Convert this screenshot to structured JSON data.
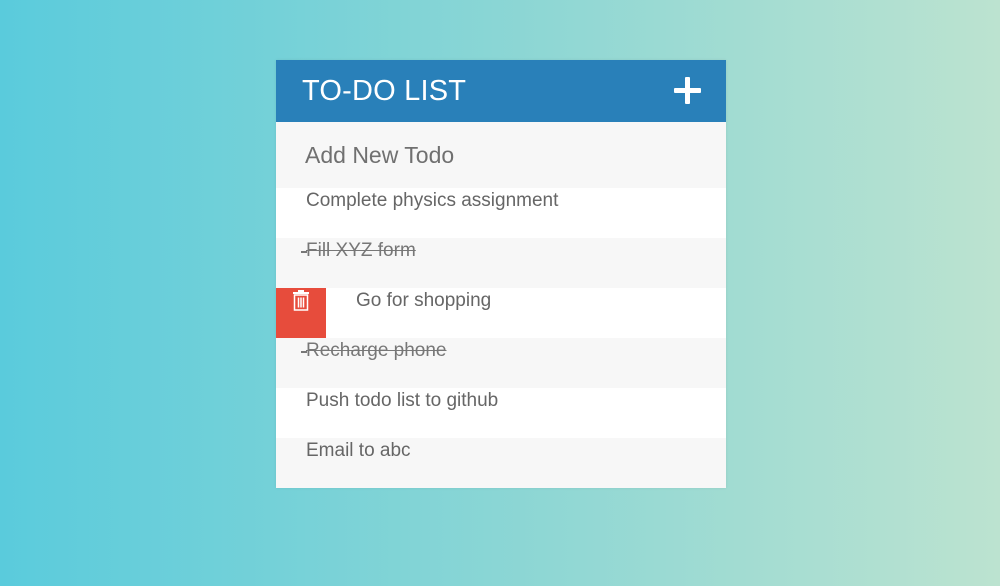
{
  "header": {
    "title": "TO-DO LIST",
    "add_icon": "plus-icon"
  },
  "input": {
    "placeholder": "Add New Todo",
    "value": ""
  },
  "todos": [
    {
      "text": "Complete physics assignment",
      "completed": false
    },
    {
      "text": "Fill XYZ form",
      "completed": true
    },
    {
      "text": "Go for shopping",
      "completed": false,
      "hovered": true,
      "action_icon": "trash-icon"
    },
    {
      "text": "Recharge phone",
      "completed": true
    },
    {
      "text": "Push todo list to github",
      "completed": false
    },
    {
      "text": "Email to abc",
      "completed": false
    }
  ],
  "colors": {
    "header": "#2980b9",
    "delete": "#e74c3c",
    "text": "#666666",
    "row_alt": "#f7f7f7",
    "background_start": "#5acbdc",
    "background_end": "#bce3d0"
  }
}
